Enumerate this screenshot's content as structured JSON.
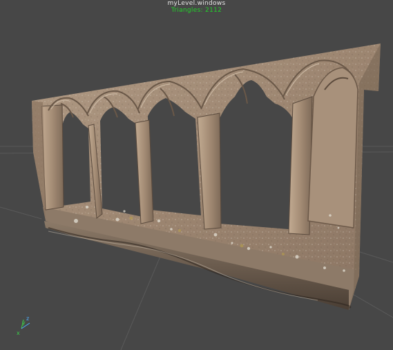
{
  "viewport": {
    "level_name": "myLevel.windows",
    "triangle_label": "Triangles: 2112",
    "background_color": "#474747",
    "grid_color": "#5a5a5a"
  },
  "model": {
    "description_icon": "gothic-arcade-window-mesh",
    "stone_color": "#a08a74",
    "shadow_color": "#5a4c40"
  },
  "axis_gizmo": {
    "x_label": "x",
    "y_label": "y",
    "z_label": "z",
    "x_color": "#3bd14a",
    "y_color": "#3bd14a",
    "z_color": "#4fb0ff"
  }
}
